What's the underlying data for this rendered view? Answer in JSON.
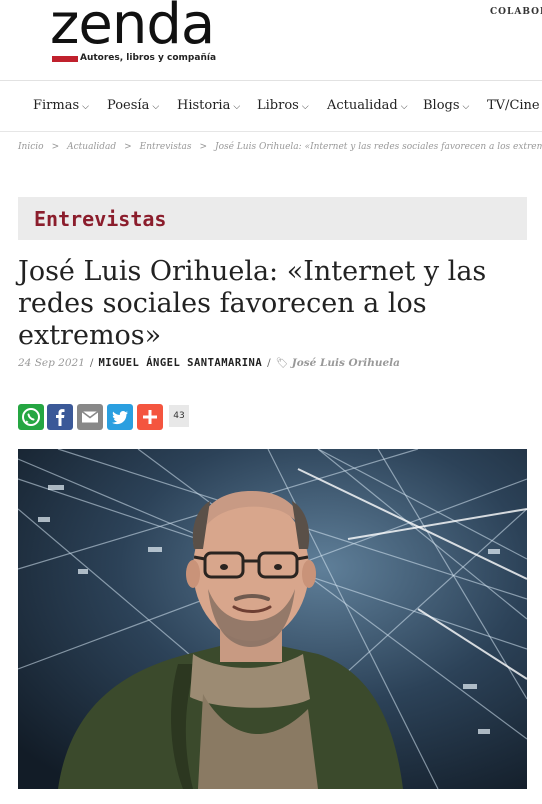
{
  "header": {
    "logo_word": "zenda",
    "logo_tagline": "Autores, libros y compañía",
    "colabora": "COLABORA"
  },
  "nav": {
    "items": [
      {
        "label": "Firmas"
      },
      {
        "label": "Poesía"
      },
      {
        "label": "Historia"
      },
      {
        "label": "Libros"
      },
      {
        "label": "Actualidad"
      },
      {
        "label": "Blogs"
      },
      {
        "label": "TV/Cine"
      }
    ]
  },
  "breadcrumb": {
    "home": "Inicio",
    "section": "Actualidad",
    "subsection": "Entrevistas",
    "current": "José Luis Orihuela: «Internet y las redes sociales favorecen a los extremos»",
    "separator": ">"
  },
  "section": {
    "label": "Entrevistas"
  },
  "article": {
    "title": "José Luis Orihuela: «Internet y las redes sociales favorecen a los extremos»",
    "date": "24 Sep 2021",
    "author": "MIGUEL ÁNGEL SANTAMARINA",
    "tag": "José Luis Orihuela",
    "share_count": "43",
    "photo_alt": "José Luis Orihuela"
  },
  "colors": {
    "accent": "#8b1d2c",
    "whatsapp": "#25a642",
    "facebook": "#3b5998",
    "email": "#888888",
    "twitter": "#2a9fe0",
    "addtoany": "#f4553f"
  }
}
